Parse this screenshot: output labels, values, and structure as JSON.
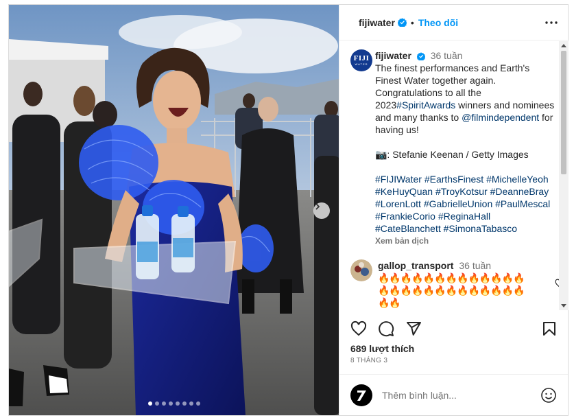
{
  "post": {
    "username": "fijiwater",
    "follow_label": "Theo dõi",
    "avatar_text": "FIJI",
    "avatar_subtext": "WATER",
    "caption": {
      "username": "fijiwater",
      "time": "36 tuần",
      "text1": "The finest performances and Earth's Finest Water together again. Congratulations to all the 2023",
      "tag_spirit": "#SpiritAwards",
      "text2": " winners and nominees and many thanks to ",
      "mention": "@filmindependent",
      "text3": " for having us!",
      "credit": "📷: Stefanie Keenan / Getty Images",
      "hashtags": "#FIJIWater #EarthsFinest #MichelleYeoh #KeHuyQuan #TroyKotsur #DeanneBray #LorenLott #GabrielleUnion #PaulMescal #FrankieCorio #ReginaHall #CateBlanchett #SimonaTabasco",
      "see_translation": "Xem bản dịch"
    },
    "comment": {
      "username": "gallop_transport",
      "time": "36 tuần",
      "text": "🔥🔥🔥🔥🔥🔥🔥🔥🔥🔥🔥🔥🔥🔥🔥🔥🔥🔥🔥🔥🔥🔥🔥🔥🔥🔥🔥🔥"
    },
    "likes": "689 lượt thích",
    "date": "8 THÁNG 3",
    "comment_placeholder": "Thêm bình luận...",
    "carousel": {
      "total": 8,
      "active_index": 0
    }
  },
  "icons": [
    "verified-badge-icon",
    "more-options-icon",
    "heart-icon",
    "comment-icon",
    "share-icon",
    "bookmark-icon",
    "emoji-icon",
    "chevron-right-icon"
  ],
  "colors": {
    "link": "#0095f6",
    "hashtag": "#00376b",
    "muted": "#737373",
    "verified": "#0095f6"
  }
}
